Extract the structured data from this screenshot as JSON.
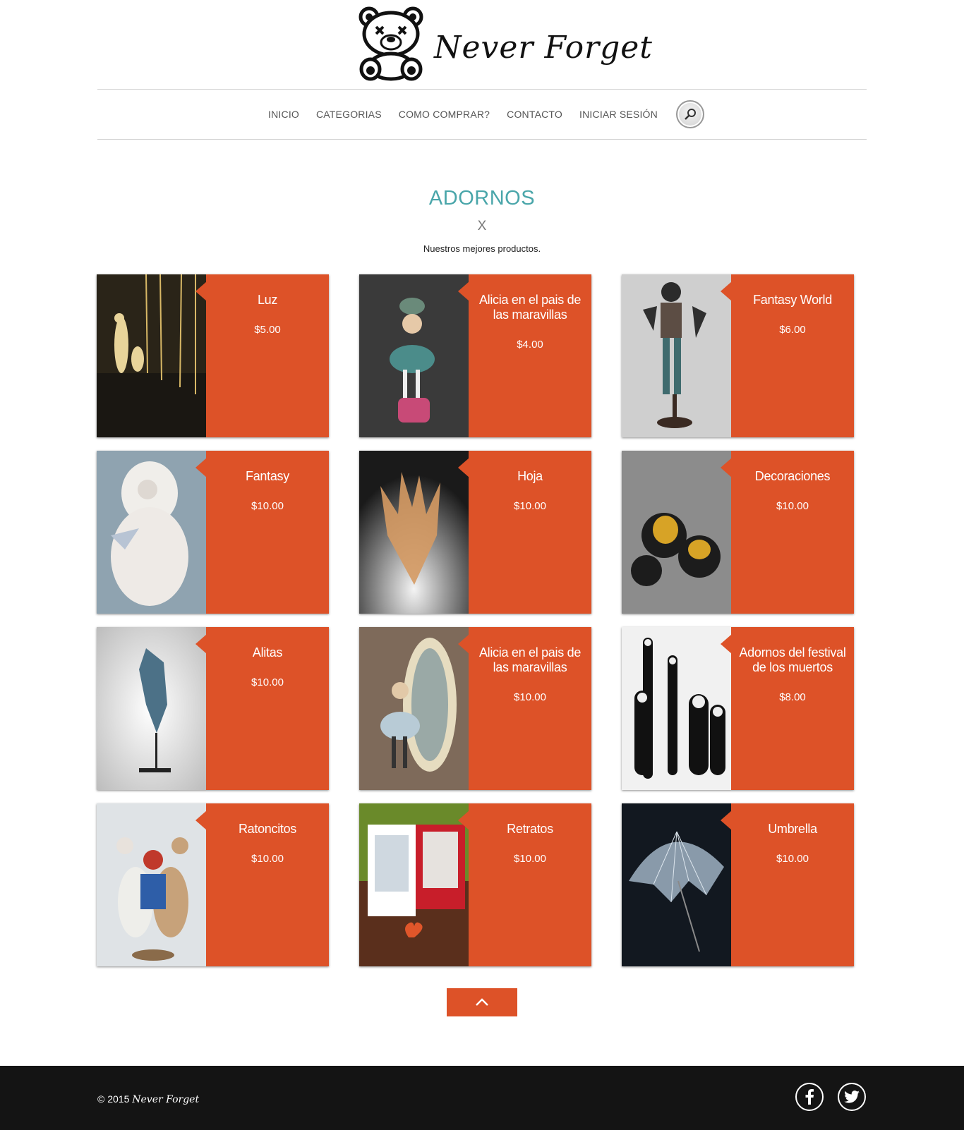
{
  "header": {
    "brand": "Never Forget"
  },
  "nav": {
    "items": [
      "INICIO",
      "CATEGORIAS",
      "COMO COMPRAR?",
      "CONTACTO",
      "INICIAR SESIÓN"
    ],
    "search_icon": "search-icon"
  },
  "section": {
    "title": "ADORNOS",
    "x": "X",
    "subtitle": "Nuestros mejores productos."
  },
  "products": [
    {
      "name": "Luz",
      "price": "$5.00"
    },
    {
      "name": "Alicia en el pais de las maravillas",
      "price": "$4.00"
    },
    {
      "name": "Fantasy World",
      "price": "$6.00"
    },
    {
      "name": "Fantasy",
      "price": "$10.00"
    },
    {
      "name": "Hoja",
      "price": "$10.00"
    },
    {
      "name": "Decoraciones",
      "price": "$10.00"
    },
    {
      "name": "Alitas",
      "price": "$10.00"
    },
    {
      "name": "Alicia en el pais de las maravillas",
      "price": "$10.00"
    },
    {
      "name": "Adornos del festival de los muertos",
      "price": "$8.00"
    },
    {
      "name": "Ratoncitos",
      "price": "$10.00"
    },
    {
      "name": "Retratos",
      "price": "$10.00"
    },
    {
      "name": "Umbrella",
      "price": "$10.00"
    }
  ],
  "footer": {
    "copyright": "© 2015",
    "brand": "Never Forget"
  },
  "colors": {
    "accent": "#dd5228",
    "title": "#4aa6aa",
    "footer_bg": "#141414"
  }
}
